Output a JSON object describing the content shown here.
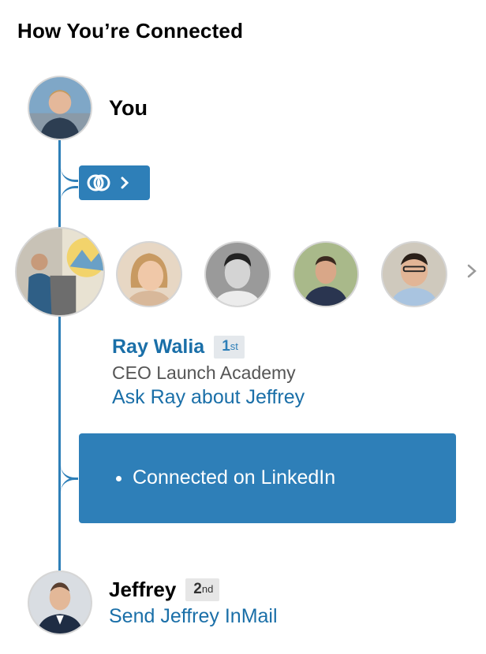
{
  "section": {
    "title": "How You’re Connected"
  },
  "you": {
    "label": "You"
  },
  "shared_connections": {
    "icon": "shared-connections-icon",
    "arrow_icon": "chevron-right-icon"
  },
  "connections": [
    {
      "avatar": "ray-walia-avatar"
    },
    {
      "avatar": "connection-avatar-2"
    },
    {
      "avatar": "connection-avatar-3"
    },
    {
      "avatar": "connection-avatar-4"
    },
    {
      "avatar": "connection-avatar-5"
    }
  ],
  "ray": {
    "name": "Ray Walia",
    "degree_num": "1",
    "degree_suffix": "st",
    "title": "CEO Launch Academy",
    "ask_link": "Ask Ray about Jeffrey"
  },
  "info_box": {
    "items": [
      "Connected on LinkedIn"
    ]
  },
  "jeffrey": {
    "name": "Jeffrey",
    "degree_num": "2",
    "degree_suffix": "nd",
    "send_link": "Send Jeffrey InMail"
  },
  "colors": {
    "accent": "#2e7fb8",
    "link": "#1a6fa8",
    "badge_bg": "#e4e8ec"
  }
}
